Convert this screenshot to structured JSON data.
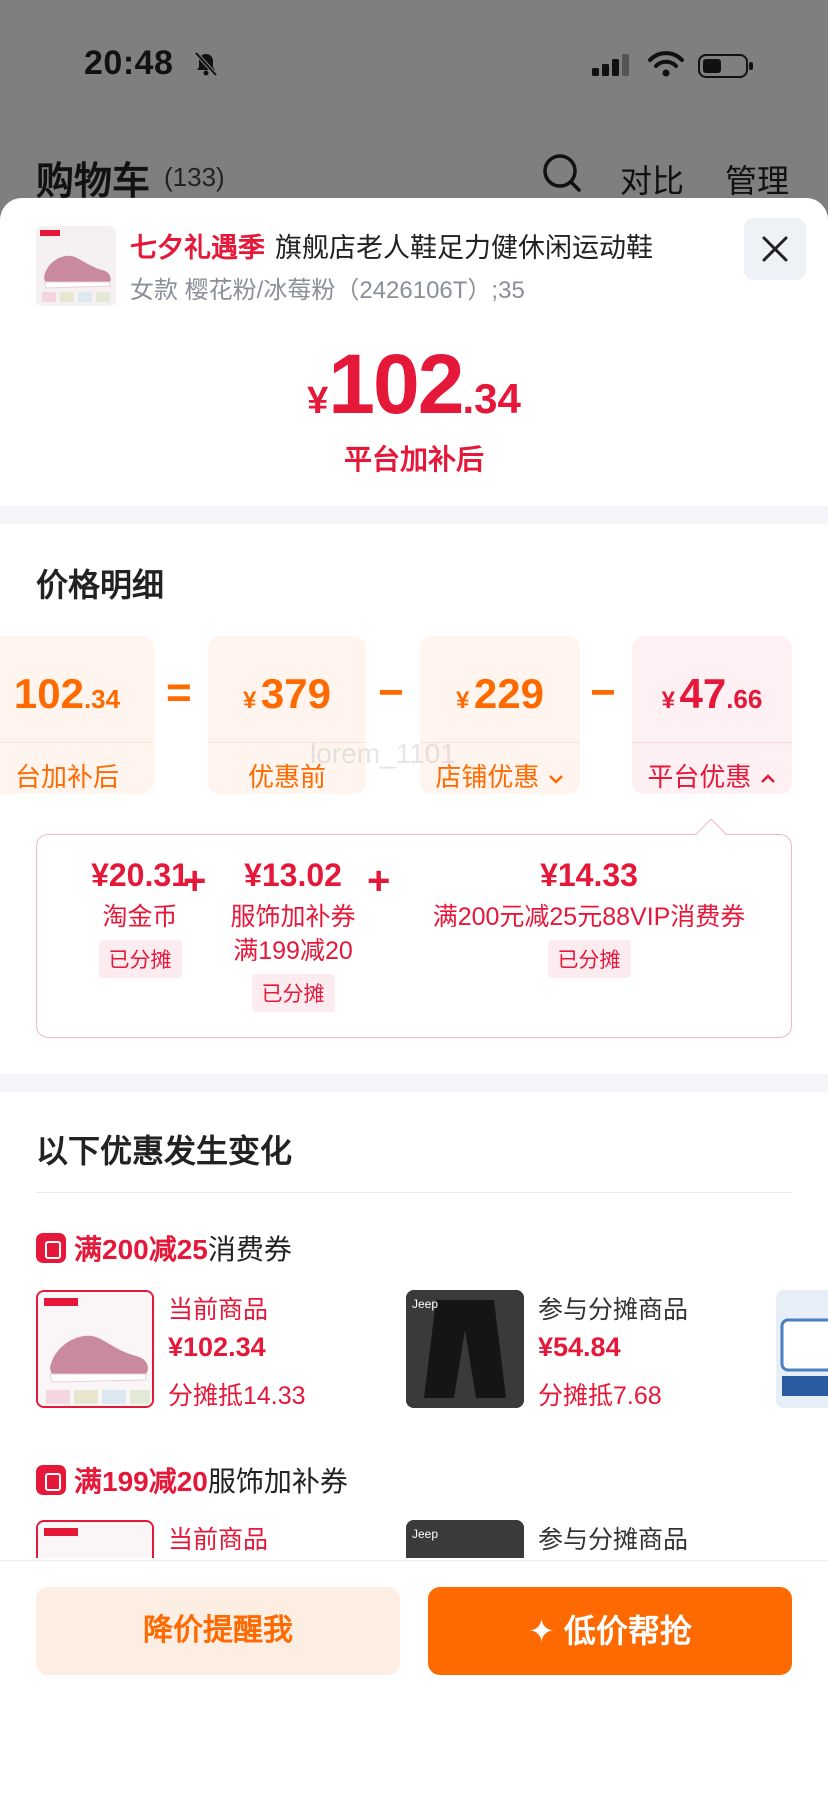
{
  "status": {
    "time": "20:48"
  },
  "header": {
    "title": "购物车",
    "count": "(133)",
    "compare": "对比",
    "manage": "管理"
  },
  "product": {
    "promo_tag": "七夕礼遇季",
    "name": "旗舰店老人鞋足力健休闲运动鞋",
    "variant": "女款 樱花粉/冰莓粉（2426106T）;35"
  },
  "final_price": {
    "yen": "¥",
    "int": "102",
    "dec": ".34",
    "label": "平台加补后"
  },
  "breakdown": {
    "title": "价格明细",
    "final": {
      "int": "102",
      "dec": ".34",
      "label": "台加补后"
    },
    "original": {
      "yen": "¥",
      "value": "379",
      "label": "优惠前"
    },
    "shop": {
      "yen": "¥",
      "value": "229",
      "label": "店铺优惠"
    },
    "platform": {
      "yen": "¥",
      "int": "47",
      "dec": ".66",
      "label": "平台优惠"
    },
    "equals": "=",
    "minus": "−",
    "details": [
      {
        "amount": "¥20.31",
        "name": "淘金币",
        "badge": "已分摊"
      },
      {
        "amount": "¥13.02",
        "name": "服饰加补券满199减20",
        "badge": "已分摊"
      },
      {
        "amount": "¥14.33",
        "name": "满200元减25元88VIP消费券",
        "badge": "已分摊"
      }
    ],
    "plus": "+"
  },
  "changes": {
    "title": "以下优惠发生变化",
    "coupons": [
      {
        "title_red": "满200减25",
        "title_rest": "消费券",
        "items": [
          {
            "label": "当前商品",
            "price": "¥102.34",
            "share": "分摊抵14.33"
          },
          {
            "label": "参与分摊商品",
            "price": "¥54.84",
            "share": "分摊抵7.68",
            "brand": "Jeep"
          }
        ]
      },
      {
        "title_red": "满199减20",
        "title_rest": "服饰加补券",
        "items": [
          {
            "label": "当前商品"
          },
          {
            "label": "参与分摊商品",
            "brand": "Jeep"
          }
        ]
      }
    ]
  },
  "footer": {
    "remind": "降价提醒我",
    "grab": "✦ 低价帮抢"
  },
  "watermark": "lorem_1101",
  "colors": {
    "accent_red": "#e5183a",
    "accent_orange": "#ff6a00"
  }
}
